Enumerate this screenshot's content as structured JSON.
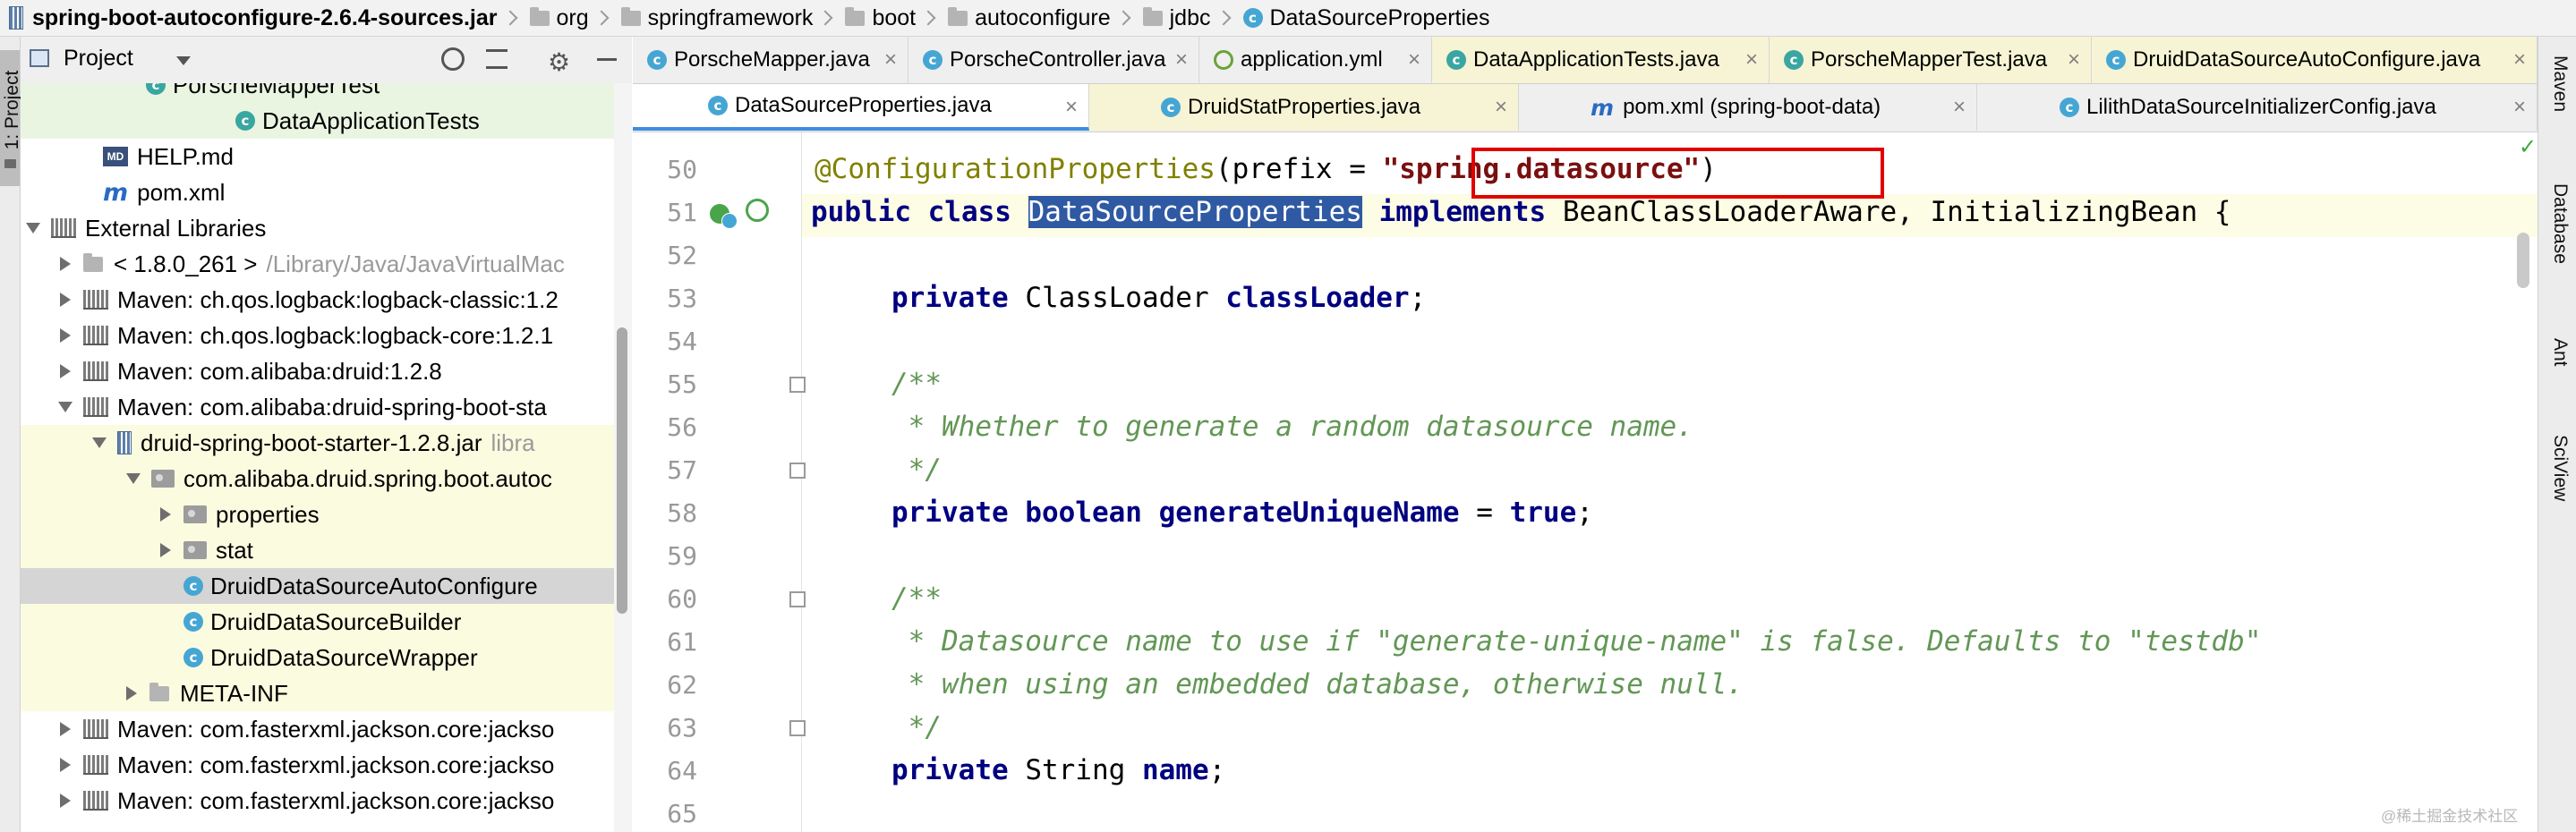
{
  "breadcrumb": [
    "spring-boot-autoconfigure-2.6.4-sources.jar",
    "org",
    "springframework",
    "boot",
    "autoconfigure",
    "jdbc",
    "DataSourceProperties"
  ],
  "project_panel": {
    "title": "Project",
    "strip_label": "1: Project"
  },
  "tree": [
    {
      "label": "PorscheMapperTest",
      "extra": ""
    },
    {
      "label": "DataApplicationTests",
      "extra": ""
    },
    {
      "label": "HELP.md",
      "extra": ""
    },
    {
      "label": "pom.xml",
      "extra": ""
    },
    {
      "label": "External Libraries",
      "extra": ""
    },
    {
      "label": "< 1.8.0_261 >",
      "extra": "/Library/Java/JavaVirtualMac"
    },
    {
      "label": "Maven: ch.qos.logback:logback-classic:1.2",
      "extra": ""
    },
    {
      "label": "Maven: ch.qos.logback:logback-core:1.2.1",
      "extra": ""
    },
    {
      "label": "Maven: com.alibaba:druid:1.2.8",
      "extra": ""
    },
    {
      "label": "Maven: com.alibaba:druid-spring-boot-sta",
      "extra": ""
    },
    {
      "label": "druid-spring-boot-starter-1.2.8.jar",
      "extra": "libra"
    },
    {
      "label": "com.alibaba.druid.spring.boot.autoc",
      "extra": ""
    },
    {
      "label": "properties",
      "extra": ""
    },
    {
      "label": "stat",
      "extra": ""
    },
    {
      "label": "DruidDataSourceAutoConfigure",
      "extra": ""
    },
    {
      "label": "DruidDataSourceBuilder",
      "extra": ""
    },
    {
      "label": "DruidDataSourceWrapper",
      "extra": ""
    },
    {
      "label": "META-INF",
      "extra": ""
    },
    {
      "label": "Maven: com.fasterxml.jackson.core:jackso",
      "extra": ""
    },
    {
      "label": "Maven: com.fasterxml.jackson.core:jackso",
      "extra": ""
    },
    {
      "label": "Maven: com.fasterxml.jackson.core:jackso",
      "extra": ""
    }
  ],
  "tabs_row1": [
    "PorscheMapper.java",
    "PorscheController.java",
    "application.yml",
    "DataApplicationTests.java",
    "PorscheMapperTest.java",
    "DruidDataSourceAutoConfigure.java"
  ],
  "tabs_row2": [
    "DataSourceProperties.java",
    "DruidStatProperties.java",
    "pom.xml (spring-boot-data)",
    "LilithDataSourceInitializerConfig.java"
  ],
  "right_tools": [
    "Maven",
    "Database",
    "Ant",
    "SciView"
  ],
  "code": {
    "line_numbers": [
      "50",
      "51",
      "52",
      "53",
      "54",
      "55",
      "56",
      "57",
      "58",
      "59",
      "60",
      "61",
      "62",
      "63",
      "64",
      "65"
    ],
    "l50": {
      "annotation": "@ConfigurationProperties",
      "open": "(prefix = ",
      "value": "\"spring.datasource\"",
      "close": ")"
    },
    "l51": {
      "kw1": "public class ",
      "class_name": "DataSourceProperties",
      "kw2": " implements ",
      "rest": "BeanClassLoaderAware, InitializingBean {"
    },
    "l53": {
      "kw": "private ",
      "type": "ClassLoader ",
      "field": "classLoader",
      "end": ";"
    },
    "l55": "/**",
    "l56": " * Whether to generate a random datasource name.",
    "l57": " */",
    "l58": {
      "kw": "private boolean ",
      "field": "generateUniqueName",
      "mid": " = ",
      "val": "true",
      "end": ";"
    },
    "l60": "/**",
    "l61": " * Datasource name to use if \"generate-unique-name\" is false. Defaults to \"testdb\"",
    "l62": " * when using an embedded database, otherwise null.",
    "l63": " */",
    "l64": {
      "kw": "private ",
      "type": "String ",
      "field": "name",
      "end": ";"
    }
  },
  "watermark": "@稀土掘金技术社区",
  "colors": {
    "selection": "#2f59a3",
    "highlight_box": "#e00000",
    "keyword": "#000080",
    "doc": "#629755"
  }
}
